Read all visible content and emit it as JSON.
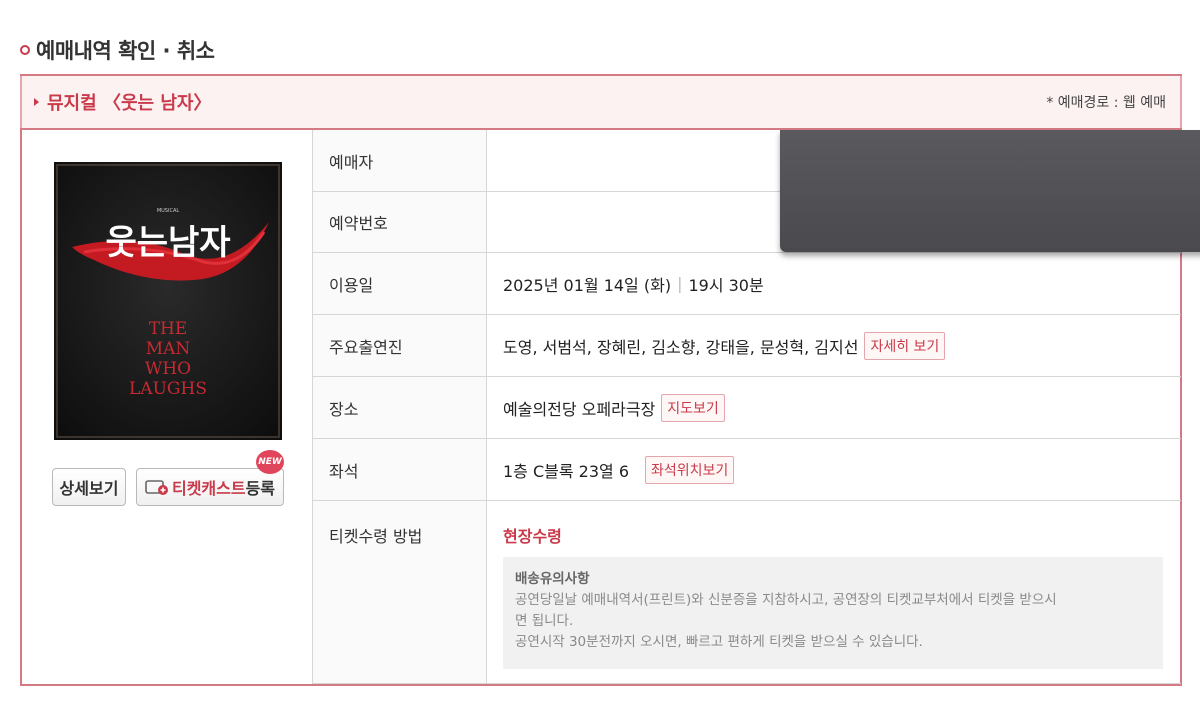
{
  "page": {
    "title": "예매내역 확인 · 취소"
  },
  "banner": {
    "show_title": "뮤지컬 〈웃는 남자〉",
    "booking_route": "* 예매경로 : 웹 예매"
  },
  "poster": {
    "small_caption": "MUSICAL",
    "korean_title": "웃는남자",
    "english_lines": [
      "THE",
      "MAN",
      "WHO",
      "LAUGHS"
    ]
  },
  "buttons": {
    "detail": "상세보기",
    "ticketcast_prefix": "티켓캐스트",
    "ticketcast_suffix": "등록",
    "new_badge": "NEW"
  },
  "details": {
    "booker_label": "예매자",
    "reservation_label": "예약번호",
    "date_label": "이용일",
    "date_value": "2025년 01월 14일 (화)",
    "time_value": "19시 30분",
    "cast_label": "주요출연진",
    "cast_value": "도영, 서범석, 장혜린, 김소향, 강태을, 문성혁, 김지선",
    "cast_link": "자세히 보기",
    "venue_label": "장소",
    "venue_value": "예술의전당 오페라극장",
    "venue_link": "지도보기",
    "seat_label": "좌석",
    "seat_value": "1층 C블록 23열 6",
    "seat_link": "좌석위치보기",
    "pickup_label": "티켓수령 방법",
    "pickup_value": "현장수령",
    "notice_title": "배송유의사항",
    "notice_line1": "공연당일날 예매내역서(프린트)와 신분증을 지참하시고, 공연장의 티켓교부처에서 티켓을 받으시",
    "notice_line2": "면 됩니다.",
    "notice_line3": "공연시작 30분전까지 오시면, 빠르고 편하게 티켓을 받으실 수 있습니다."
  },
  "colors": {
    "accent": "#c93a4a",
    "border": "#d37a84",
    "banner_bg": "#fdf2f2",
    "redaction": "#505054"
  }
}
